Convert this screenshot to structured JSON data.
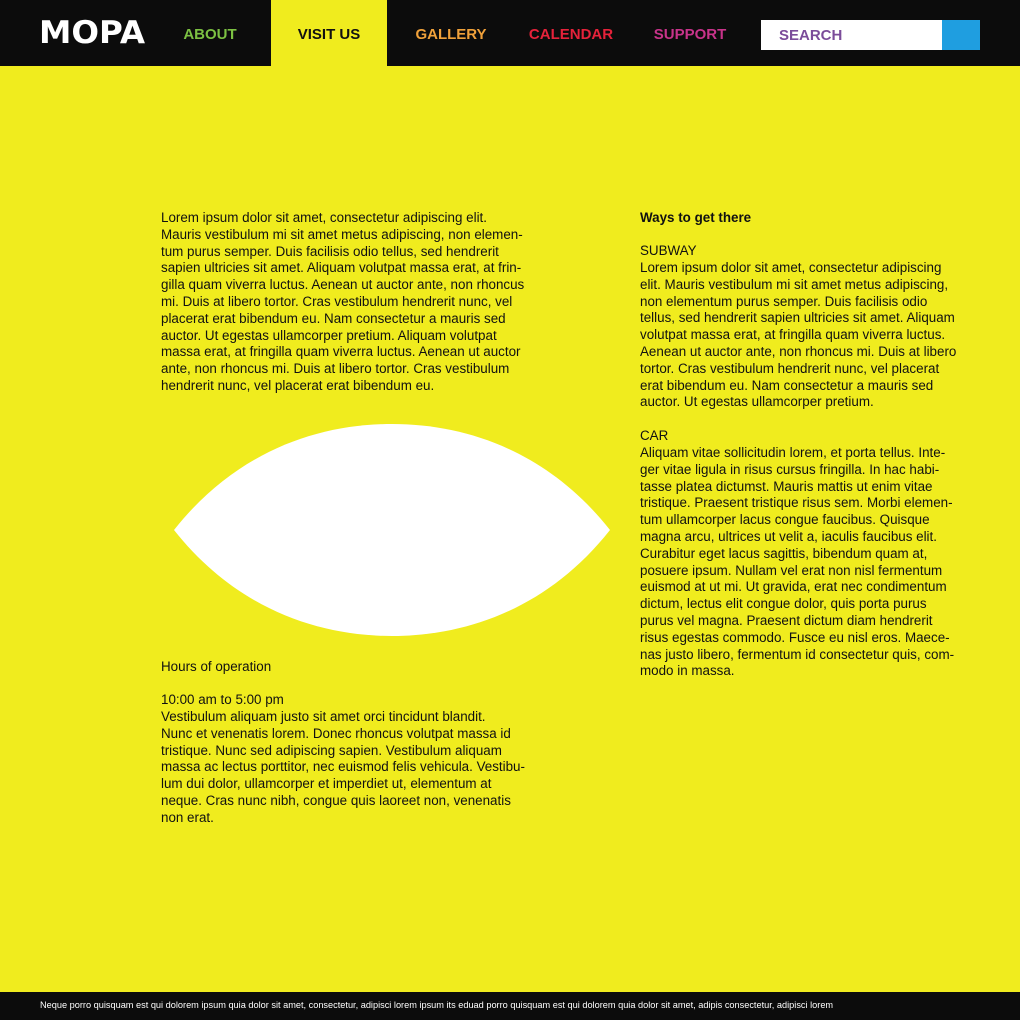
{
  "header": {
    "logo": "MOPA",
    "nav": [
      {
        "label": "ABOUT",
        "color": "#7cc142"
      },
      {
        "label": "VISIT US",
        "color": "#111111"
      },
      {
        "label": "GALLERY",
        "color": "#f0a13a"
      },
      {
        "label": "CALENDAR",
        "color": "#e6223a"
      },
      {
        "label": "SUPPORT",
        "color": "#c8338a"
      }
    ],
    "search": {
      "placeholder": "SEARCH"
    }
  },
  "main": {
    "intro": "Lorem ipsum dolor sit amet, consectetur adipiscing elit.\nMauris vestibulum mi sit amet metus adipiscing, non elemen-\ntum purus semper. Duis facilisis odio tellus, sed hendrerit\nsapien ultricies sit amet. Aliquam volutpat massa erat, at frin-\ngilla quam viverra luctus. Aenean ut auctor ante, non rhoncus\nmi. Duis at libero tortor. Cras vestibulum hendrerit nunc, vel\nplacerat erat bibendum eu. Nam consectetur a mauris sed\nauctor. Ut egestas ullamcorper pretium. Aliquam volutpat\nmassa erat, at fringilla quam viverra luctus. Aenean ut auctor\nante, non rhoncus mi. Duis at libero tortor. Cras vestibulum\nhendrerit nunc, vel placerat erat bibendum eu.",
    "hours_heading": "Hours of operation",
    "hours_time": "10:00 am to 5:00 pm",
    "hours_text": " Vestibulum aliquam justo sit amet orci tincidunt blandit.\nNunc et venenatis lorem. Donec rhoncus volutpat massa id\ntristique. Nunc sed adipiscing sapien. Vestibulum aliquam\nmassa ac lectus porttitor, nec euismod felis vehicula. Vestibu-\nlum dui dolor, ullamcorper et imperdiet ut, elementum at\nneque. Cras nunc nibh, congue quis laoreet non, venenatis\nnon erat.",
    "ways_heading": "Ways to get there",
    "subway_heading": "SUBWAY",
    "subway_text": "Lorem ipsum dolor sit amet, consectetur adipiscing\nelit. Mauris vestibulum mi sit amet metus adipiscing,\nnon elementum purus semper. Duis facilisis odio\ntellus, sed hendrerit sapien ultricies sit amet. Aliquam\nvolutpat massa erat, at fringilla quam viverra luctus.\nAenean ut auctor ante, non rhoncus mi. Duis at libero\ntortor. Cras vestibulum hendrerit nunc, vel placerat\nerat bibendum eu. Nam consectetur a mauris sed\nauctor. Ut egestas ullamcorper pretium.",
    "car_heading": "CAR",
    "car_text": "Aliquam vitae sollicitudin lorem, et porta tellus. Inte-\nger vitae ligula in risus cursus fringilla. In hac habi-\ntasse platea dictumst. Mauris mattis ut enim vitae\ntristique. Praesent tristique risus sem. Morbi elemen-\ntum ullamcorper lacus congue faucibus. Quisque\nmagna arcu, ultrices ut velit a, iaculis faucibus elit.\nCurabitur eget lacus sagittis, bibendum quam at,\nposuere ipsum. Nullam vel erat non nisl fermentum\neuismod at ut mi. Ut gravida, erat nec condimentum\ndictum, lectus elit congue dolor, quis porta purus\npurus vel magna. Praesent dictum diam hendrerit\nrisus egestas commodo. Fusce eu nisl eros. Maece-\nnas justo libero, fermentum id consectetur quis, com-\nmodo in massa."
  },
  "footer": {
    "text": "Neque porro quisquam est qui dolorem ipsum quia dolor sit amet, consectetur, adipisci lorem ipsum its eduad porro quisquam est qui dolorem quia dolor sit amet, adipis  consectetur, adipisci lorem"
  },
  "colors": {
    "background": "#f0ec1e",
    "header_bg": "#0c0c0c",
    "search_text": "#7b4c9a",
    "search_button": "#1f9ee0"
  }
}
